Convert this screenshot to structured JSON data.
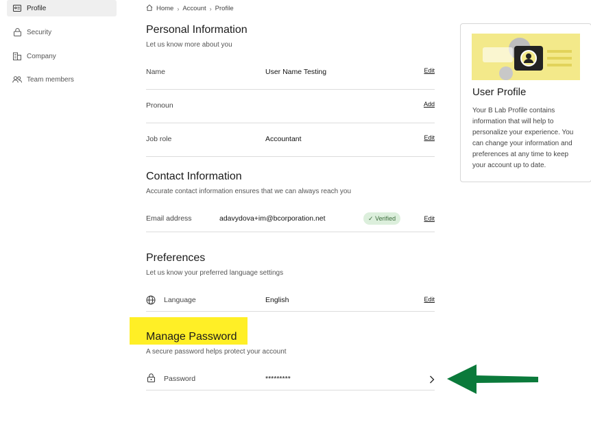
{
  "sidebar": {
    "items": [
      {
        "label": "Profile",
        "icon": "id-card-icon",
        "active": true
      },
      {
        "label": "Security",
        "icon": "lock-icon",
        "active": false
      },
      {
        "label": "Company",
        "icon": "building-icon",
        "active": false
      },
      {
        "label": "Team members",
        "icon": "people-icon",
        "active": false
      }
    ]
  },
  "breadcrumb": [
    "Home",
    "Account",
    "Profile"
  ],
  "personal": {
    "title": "Personal Information",
    "subtitle": "Let us know more about you",
    "rows": [
      {
        "label": "Name",
        "value": "User Name Testing",
        "action": "Edit"
      },
      {
        "label": "Pronoun",
        "value": "",
        "action": "Add"
      },
      {
        "label": "Job role",
        "value": "Accountant",
        "action": "Edit"
      }
    ]
  },
  "contact": {
    "title": "Contact Information",
    "subtitle": "Accurate contact information ensures that we can always reach you",
    "email_label": "Email address",
    "email_value": "adavydova+im@bcorporation.net",
    "verified_label": "Verified",
    "action": "Edit"
  },
  "preferences": {
    "title": "Preferences",
    "subtitle": "Let us know your preferred language settings",
    "language_label": "Language",
    "language_value": "English",
    "action": "Edit"
  },
  "password": {
    "title": "Manage Password",
    "subtitle": "A secure password helps protect your account",
    "label": "Password",
    "value": "*********"
  },
  "card": {
    "title": "User Profile",
    "body": "Your B Lab Profile contains information that will help to personalize your experience. You can change your information and preferences at any time to keep your account up to date."
  },
  "colors": {
    "highlight": "#ffef26",
    "annotation_arrow": "#0b7a3b",
    "verified_bg": "#dcefdc",
    "illustration_yellow": "#f3e98a"
  }
}
